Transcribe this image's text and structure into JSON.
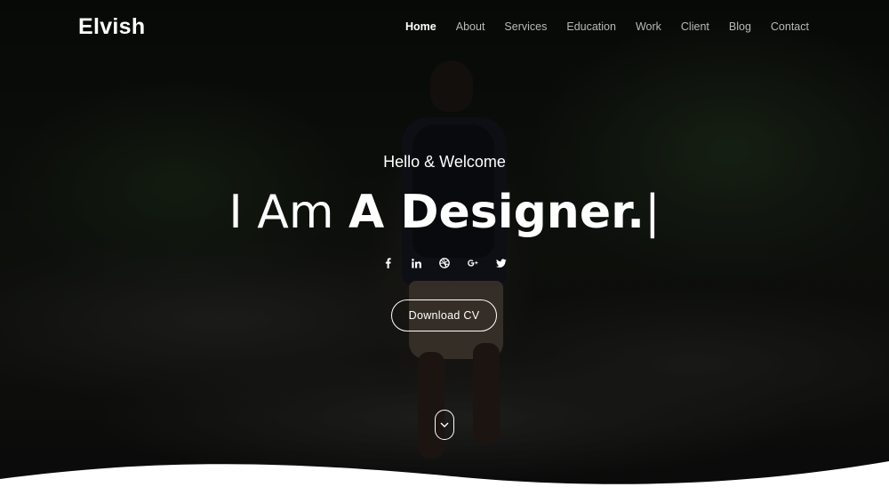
{
  "brand": {
    "logo": "Elvish"
  },
  "nav": {
    "items": [
      {
        "label": "Home",
        "active": true
      },
      {
        "label": "About"
      },
      {
        "label": "Services"
      },
      {
        "label": "Education"
      },
      {
        "label": "Work"
      },
      {
        "label": "Client"
      },
      {
        "label": "Blog"
      },
      {
        "label": "Contact"
      }
    ]
  },
  "hero": {
    "greeting": "Hello & Welcome",
    "headline_prefix": "I Am",
    "headline_role": "A Designer.",
    "cursor": "|",
    "cta_label": "Download CV",
    "social_icons": [
      "facebook-icon",
      "linkedin-icon",
      "dribbble-icon",
      "google-plus-icon",
      "twitter-icon"
    ]
  },
  "colors": {
    "text": "#ffffff",
    "nav_inactive": "#b9b9b9",
    "overlay": "#000000",
    "page_bg": "#ffffff"
  }
}
